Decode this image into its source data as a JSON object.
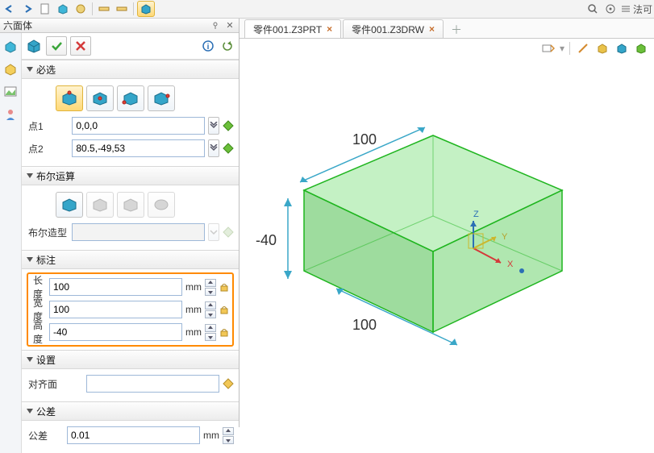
{
  "app": {
    "top_right_label": "法可"
  },
  "panel": {
    "title": "六面体"
  },
  "sections": {
    "required": "必选",
    "boolean": "布尔运算",
    "annot": "标注",
    "settings": "设置",
    "tolerance": "公差"
  },
  "fields": {
    "pt1_lbl": "点1",
    "pt1_val": "0,0,0",
    "pt2_lbl": "点2",
    "pt2_val": "80.5,-49,53",
    "bool_shape_lbl": "布尔造型",
    "bool_shape_val": "",
    "len_lbl": "长度",
    "len_val": "100",
    "wid_lbl": "宽度",
    "wid_val": "100",
    "hgt_lbl": "高度",
    "hgt_val": "-40",
    "unit_mm": "mm",
    "align_lbl": "对齐面",
    "align_val": "",
    "tol_lbl": "公差",
    "tol_val": "0.01"
  },
  "tabs": {
    "t1": "零件001.Z3PRT",
    "t2": "零件001.Z3DRW"
  },
  "dims": {
    "d1": "100",
    "d2": "100",
    "d3": "-40"
  },
  "axes": {
    "x": "X",
    "y": "Y",
    "z": "Z"
  }
}
